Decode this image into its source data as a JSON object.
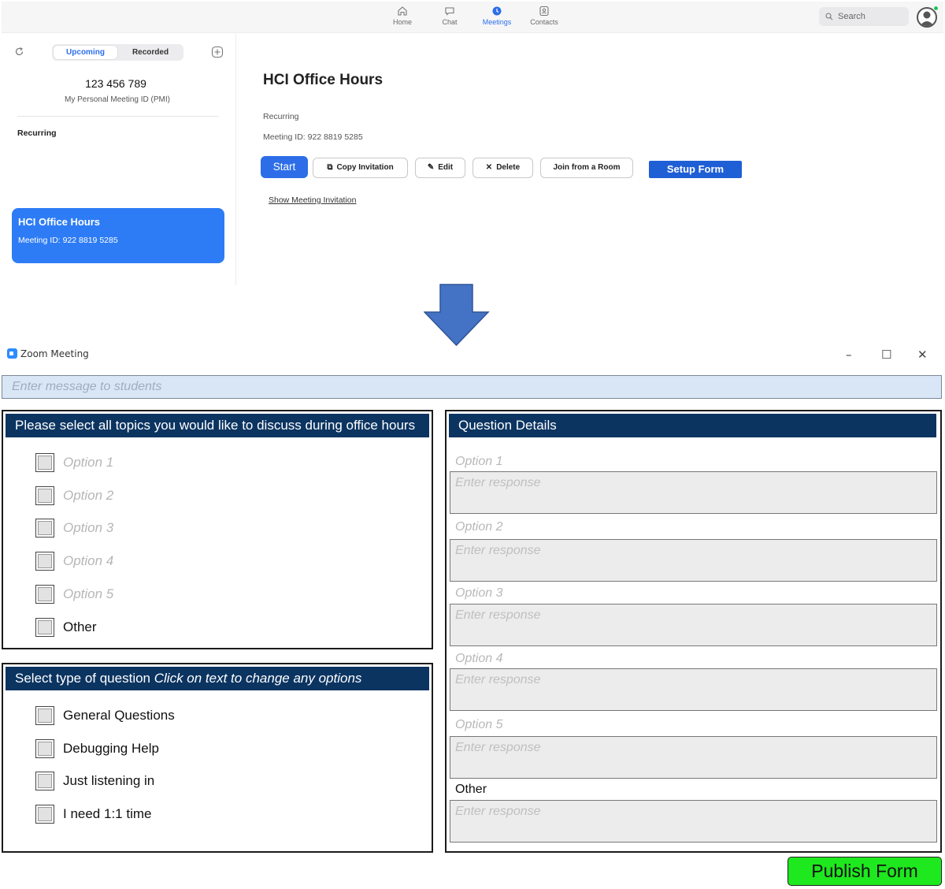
{
  "zoom_app": {
    "nav": [
      {
        "label": "Home",
        "icon": "home-icon"
      },
      {
        "label": "Chat",
        "icon": "chat-icon"
      },
      {
        "label": "Meetings",
        "icon": "meetings-icon",
        "active": true
      },
      {
        "label": "Contacts",
        "icon": "contacts-icon"
      }
    ],
    "search_placeholder": "Search",
    "sidebar": {
      "tabs": [
        "Upcoming",
        "Recorded"
      ],
      "pmi_number": "123 456 789",
      "pmi_label": "My Personal Meeting ID (PMI)",
      "section_heading": "Recurring",
      "meeting_card": {
        "title": "HCI Office Hours",
        "meeting_id": "Meeting ID: 922 8819 5285"
      }
    },
    "details": {
      "title": "HCI Office Hours",
      "recurring": "Recurring",
      "meeting_id": "Meeting ID: 922 8819 5285",
      "buttons": {
        "start": "Start",
        "copy": "Copy Invitation",
        "edit": "Edit",
        "delete": "Delete",
        "join_room": "Join from a Room",
        "setup_form": "Setup Form"
      },
      "show_invitation": "Show Meeting Invitation"
    },
    "accent_color": "#2d6ee8"
  },
  "form_window": {
    "title": "Zoom Meeting",
    "controls": {
      "minimize": "–",
      "maximize": "☐",
      "close": "✕"
    },
    "message_placeholder": "Enter message to students",
    "topics": {
      "heading": "Please select all topics you would like to discuss during office hours",
      "options": [
        "Option 1",
        "Option 2",
        "Option 3",
        "Option 4",
        "Option 5"
      ],
      "other": "Other"
    },
    "question_type": {
      "heading": "Select type of question",
      "hint": "Click on text to change any options",
      "options": [
        "General Questions",
        "Debugging Help",
        "Just listening in",
        "I need 1:1 time"
      ]
    },
    "question_details": {
      "heading": "Question Details",
      "items": [
        "Option 1",
        "Option 2",
        "Option 3",
        "Option 4",
        "Option 5",
        "Other"
      ],
      "response_placeholder": "Enter response"
    },
    "publish_button": "Publish Form",
    "header_color": "#0b3461",
    "publish_color": "#1ee81e"
  }
}
